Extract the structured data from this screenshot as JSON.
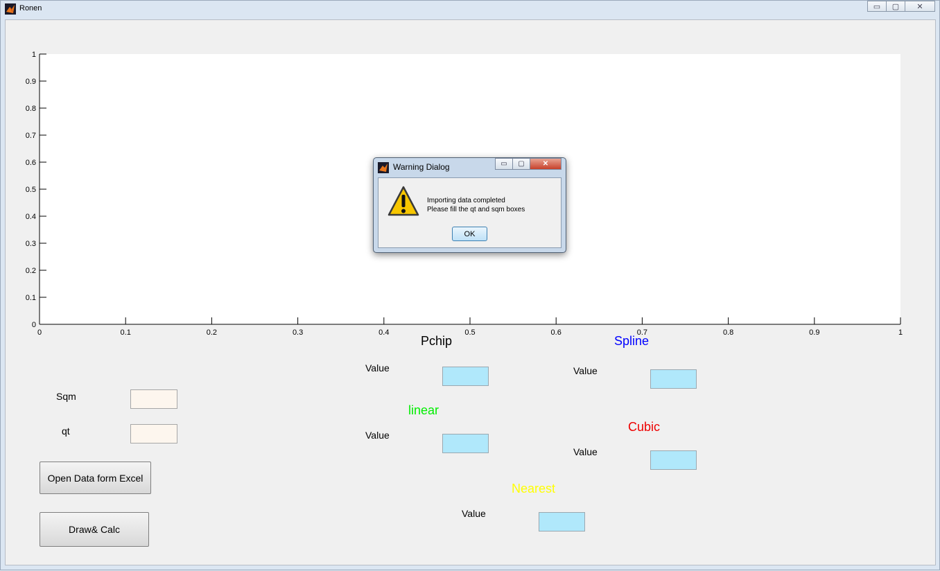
{
  "window": {
    "title": "Ronen",
    "min_symbol": "▭",
    "max_symbol": "▢",
    "close_symbol": "✕"
  },
  "chart_data": {
    "type": "line",
    "title": "",
    "xlabel": "",
    "ylabel": "",
    "xlim": [
      0,
      1
    ],
    "ylim": [
      0,
      1
    ],
    "xticks": [
      "0",
      "0.1",
      "0.2",
      "0.3",
      "0.4",
      "0.5",
      "0.6",
      "0.7",
      "0.8",
      "0.9",
      "1"
    ],
    "yticks": [
      "0",
      "0.1",
      "0.2",
      "0.3",
      "0.4",
      "0.5",
      "0.6",
      "0.7",
      "0.8",
      "0.9",
      "1"
    ],
    "series": []
  },
  "inputs": {
    "sqm_label": "Sqm",
    "qt_label": "qt"
  },
  "buttons": {
    "open_excel": "Open Data form Excel",
    "draw_calc": "Draw& Calc"
  },
  "methods": {
    "pchip": {
      "label": "Pchip",
      "value_label": "Value",
      "color": "#000000"
    },
    "spline": {
      "label": "Spline",
      "value_label": "Value",
      "color": "#0000ff"
    },
    "linear": {
      "label": "linear",
      "value_label": "Value",
      "color": "#00ee00"
    },
    "cubic": {
      "label": "Cubic",
      "value_label": "Value",
      "color": "#ee0000"
    },
    "nearest": {
      "label": "Nearest",
      "value_label": "Value",
      "color": "#ffff00"
    }
  },
  "dialog": {
    "title": "Warning Dialog",
    "line1": "Importing data completed",
    "line2": "Please fill the qt and sqm boxes",
    "ok": "OK",
    "icon": "warning-icon"
  }
}
